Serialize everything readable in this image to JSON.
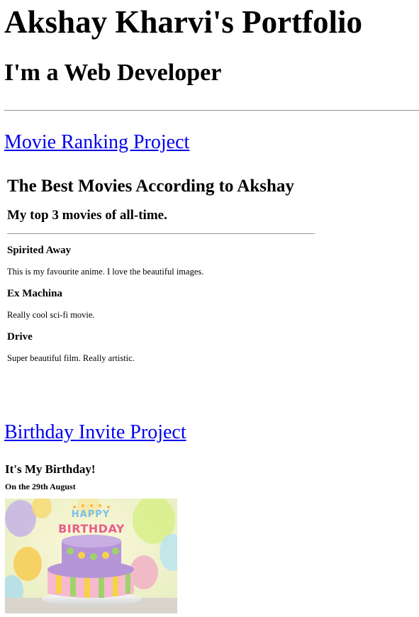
{
  "header": {
    "title": "Akshay Kharvi's Portfolio",
    "subtitle": "I'm a Web Developer"
  },
  "projects": [
    {
      "link_label": "Movie Ranking Project",
      "embed": {
        "heading": "The Best Movies According to Akshay",
        "subheading": "My top 3 movies of all-time.",
        "movies": [
          {
            "title": "Spirited Away",
            "description": "This is my favourite anime. I love the beautiful images."
          },
          {
            "title": "Ex Machina",
            "description": "Really cool sci-fi movie."
          },
          {
            "title": "Drive",
            "description": "Super beautiful film. Really artistic."
          }
        ]
      }
    },
    {
      "link_label": "Birthday Invite Project",
      "embed": {
        "heading": "It's My Birthday!",
        "subheading": "On the 29th August",
        "image_label": "birthday cake"
      }
    }
  ],
  "colors": {
    "link": "#0000ee",
    "rule": "#9a9a9a"
  }
}
